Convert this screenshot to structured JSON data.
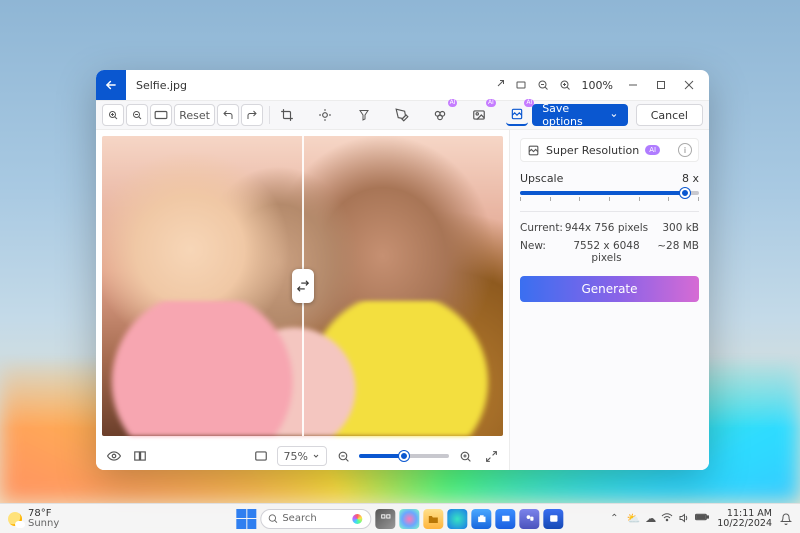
{
  "titlebar": {
    "filename": "Selfie.jpg",
    "zoom_display": "100%"
  },
  "toolbar": {
    "reset_label": "Reset",
    "save_label": "Save options",
    "cancel_label": "Cancel"
  },
  "panel": {
    "title": "Super Resolution",
    "ai_badge": "AI",
    "upscale_label": "Upscale",
    "upscale_value": "8 x",
    "current_label": "Current:",
    "current_dims": "944x 756 pixels",
    "current_size": "300 kB",
    "new_label": "New:",
    "new_dims": "7552 x 6048 pixels",
    "new_size": "~28 MB",
    "generate_label": "Generate"
  },
  "bottombar": {
    "fit_pct": "75%"
  },
  "taskbar": {
    "temp": "78°F",
    "condition": "Sunny",
    "search_placeholder": "Search",
    "time": "11:11 AM",
    "date": "10/22/2024"
  }
}
